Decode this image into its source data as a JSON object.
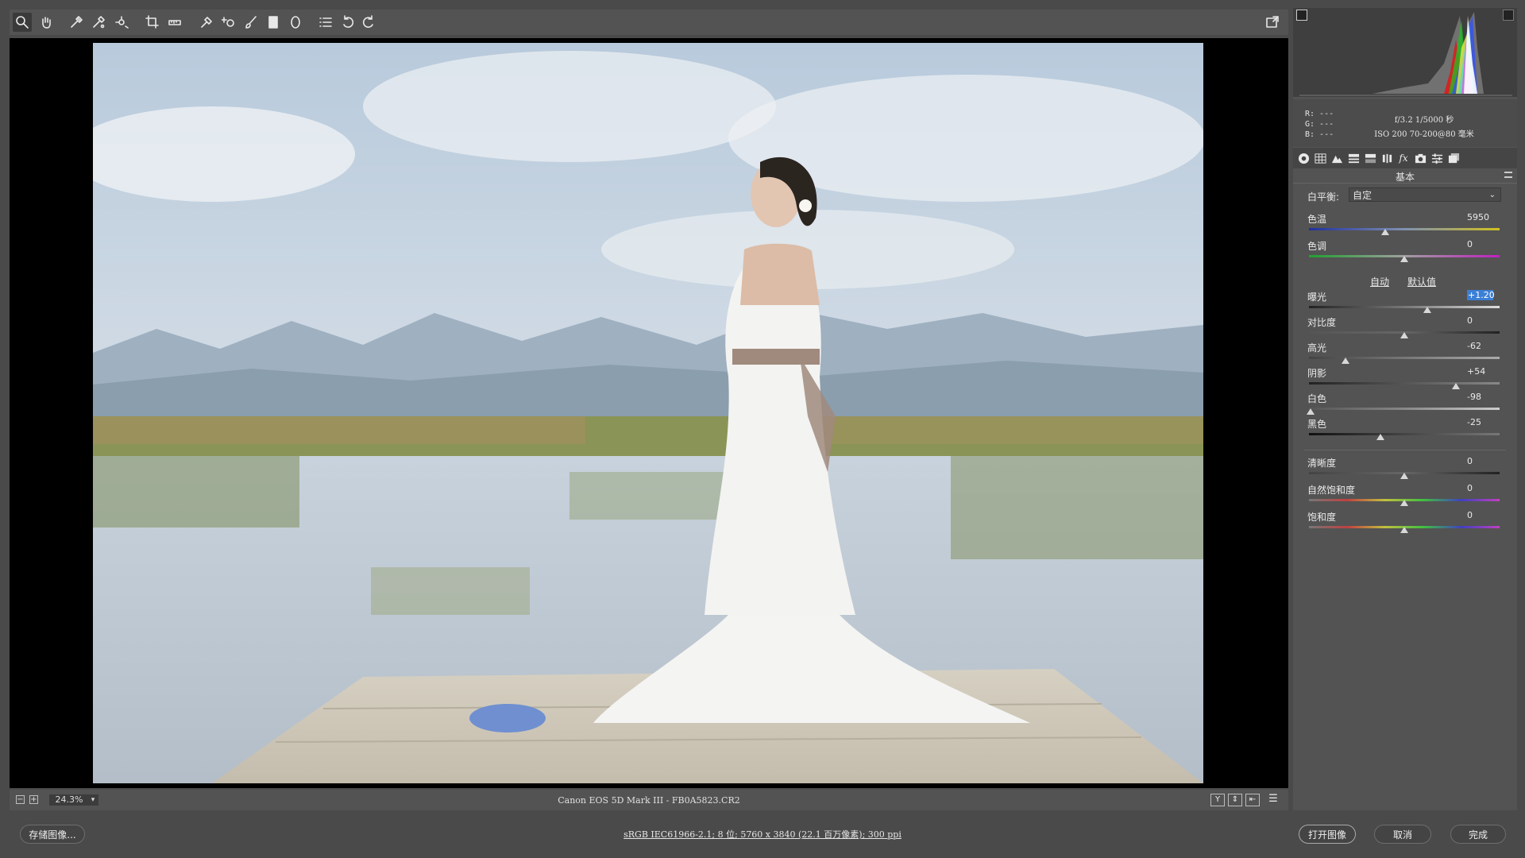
{
  "toolbar": {
    "tools": [
      "zoom-tool",
      "hand-tool",
      "white-balance-tool",
      "color-sampler-tool",
      "target-adjustment-tool",
      "crop-tool",
      "straighten-tool",
      "spot-removal-tool",
      "red-eye-tool",
      "adjustment-brush-tool",
      "graduated-filter-tool",
      "radial-filter-tool",
      "presets-tool",
      "rotate-ccw-tool",
      "rotate-cw-tool"
    ]
  },
  "status": {
    "zoom": "24.3%",
    "filename": "Canon EOS 5D Mark III -  FB0A5823.CR2"
  },
  "bottom": {
    "save_label": "存储图像...",
    "workflow": "sRGB IEC61966-2.1; 8 位; 5760 x 3840 (22.1 百万像素); 300 ppi",
    "open_label": "打开图像",
    "cancel_label": "取消",
    "done_label": "完成"
  },
  "info": {
    "r": "R:  ---",
    "g": "G:  ---",
    "b": "B:  ---",
    "aperture_shutter": "f/3.2  1/5000 秒",
    "iso_lens": "ISO 200  70-200@80 毫米"
  },
  "panel": {
    "section_title": "基本",
    "wb_label": "白平衡:",
    "wb_value": "自定",
    "auto_label": "自动",
    "default_label": "默认值",
    "sliders": [
      {
        "id": "temp",
        "label": "色温",
        "value": "5950",
        "pos": 0.4
      },
      {
        "id": "tint",
        "label": "色调",
        "value": "0",
        "pos": 0.5
      },
      {
        "id": "exposure",
        "label": "曝光",
        "value": "+1.20",
        "pos": 0.62
      },
      {
        "id": "contrast",
        "label": "对比度",
        "value": "0",
        "pos": 0.5
      },
      {
        "id": "highlights",
        "label": "高光",
        "value": "-62",
        "pos": 0.19
      },
      {
        "id": "shadows",
        "label": "阴影",
        "value": "+54",
        "pos": 0.77
      },
      {
        "id": "whites",
        "label": "白色",
        "value": "-98",
        "pos": 0.01
      },
      {
        "id": "blacks",
        "label": "黑色",
        "value": "-25",
        "pos": 0.375
      },
      {
        "id": "clarity",
        "label": "清晰度",
        "value": "0",
        "pos": 0.5
      },
      {
        "id": "vibrance",
        "label": "自然饱和度",
        "value": "0",
        "pos": 0.5
      },
      {
        "id": "saturation",
        "label": "饱和度",
        "value": "0",
        "pos": 0.5
      }
    ]
  },
  "colors": {
    "accent_highlight": "#3b7fd6"
  }
}
